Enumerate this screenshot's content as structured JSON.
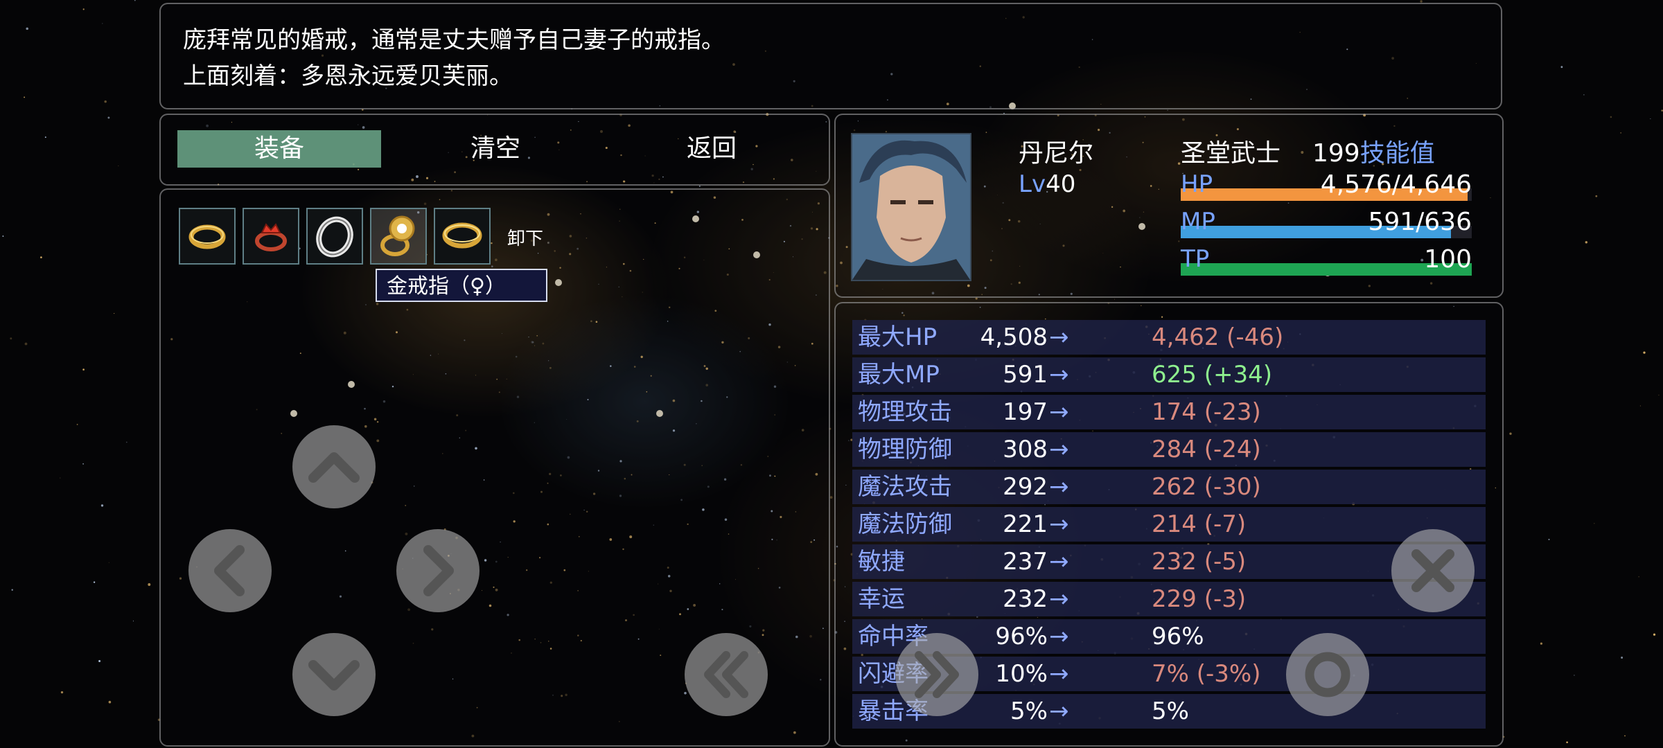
{
  "help": {
    "line1": "庞拜常见的婚戒，通常是丈夫赠予自己妻子的戒指。",
    "line2": "上面刻着：多恩永远爱贝芙丽。"
  },
  "commands": {
    "equip": "装备",
    "clear": "清空",
    "back": "返回"
  },
  "items": {
    "slots": [
      {
        "icon": "gold-ring-icon"
      },
      {
        "icon": "red-jewel-ring-icon"
      },
      {
        "icon": "silver-ring-icon"
      },
      {
        "icon": "gold-diamond-ring-icon",
        "selected": true
      },
      {
        "icon": "gold-ring-icon"
      }
    ],
    "unequip_label": "卸下",
    "tooltip": "金戒指（♀）"
  },
  "actor": {
    "name": "丹尼尔",
    "level_prefix": "Lv",
    "level": "40",
    "class": "圣堂武士",
    "skill_points": "199",
    "skill_label": "技能值",
    "hp": {
      "label": "HP",
      "current": 4576,
      "max": 4646,
      "text": "4,576/4,646",
      "color": "#f3953f"
    },
    "mp": {
      "label": "MP",
      "current": 591,
      "max": 636,
      "text": "591/636",
      "color": "#409fdf"
    },
    "tp": {
      "label": "TP",
      "current": 100,
      "max": 100,
      "text": "100",
      "color": "#1ea553"
    }
  },
  "params": [
    {
      "name": "最大HP",
      "current": "4,508",
      "arrow": "→",
      "new": "4,462 (-46)",
      "trend": "down"
    },
    {
      "name": "最大MP",
      "current": "591",
      "arrow": "→",
      "new": "625 (+34)",
      "trend": "up"
    },
    {
      "name": "物理攻击",
      "current": "197",
      "arrow": "→",
      "new": "174 (-23)",
      "trend": "down"
    },
    {
      "name": "物理防御",
      "current": "308",
      "arrow": "→",
      "new": "284 (-24)",
      "trend": "down"
    },
    {
      "name": "魔法攻击",
      "current": "292",
      "arrow": "→",
      "new": "262 (-30)",
      "trend": "down"
    },
    {
      "name": "魔法防御",
      "current": "221",
      "arrow": "→",
      "new": "214 (-7)",
      "trend": "down"
    },
    {
      "name": "敏捷",
      "current": "237",
      "arrow": "→",
      "new": "232 (-5)",
      "trend": "down"
    },
    {
      "name": "幸运",
      "current": "232",
      "arrow": "→",
      "new": "229 (-3)",
      "trend": "down"
    },
    {
      "name": "命中率",
      "current": "96%",
      "arrow": "→",
      "new": "96%",
      "trend": "same"
    },
    {
      "name": "闪避率",
      "current": "10%",
      "arrow": "→",
      "new": "7% (-3%)",
      "trend": "down"
    },
    {
      "name": "暴击率",
      "current": "5%",
      "arrow": "→",
      "new": "5%",
      "trend": "same"
    }
  ],
  "colors": {
    "up": "#8ef08e",
    "down": "#d9897d",
    "same": "#ffffff",
    "system": "#78a2ff",
    "selected": "#6eaa8c"
  },
  "touch_buttons": [
    "dpad-up-button",
    "dpad-left-button",
    "dpad-right-button",
    "dpad-down-button",
    "page-back-button",
    "page-forward-button",
    "cancel-button",
    "ok-button"
  ]
}
